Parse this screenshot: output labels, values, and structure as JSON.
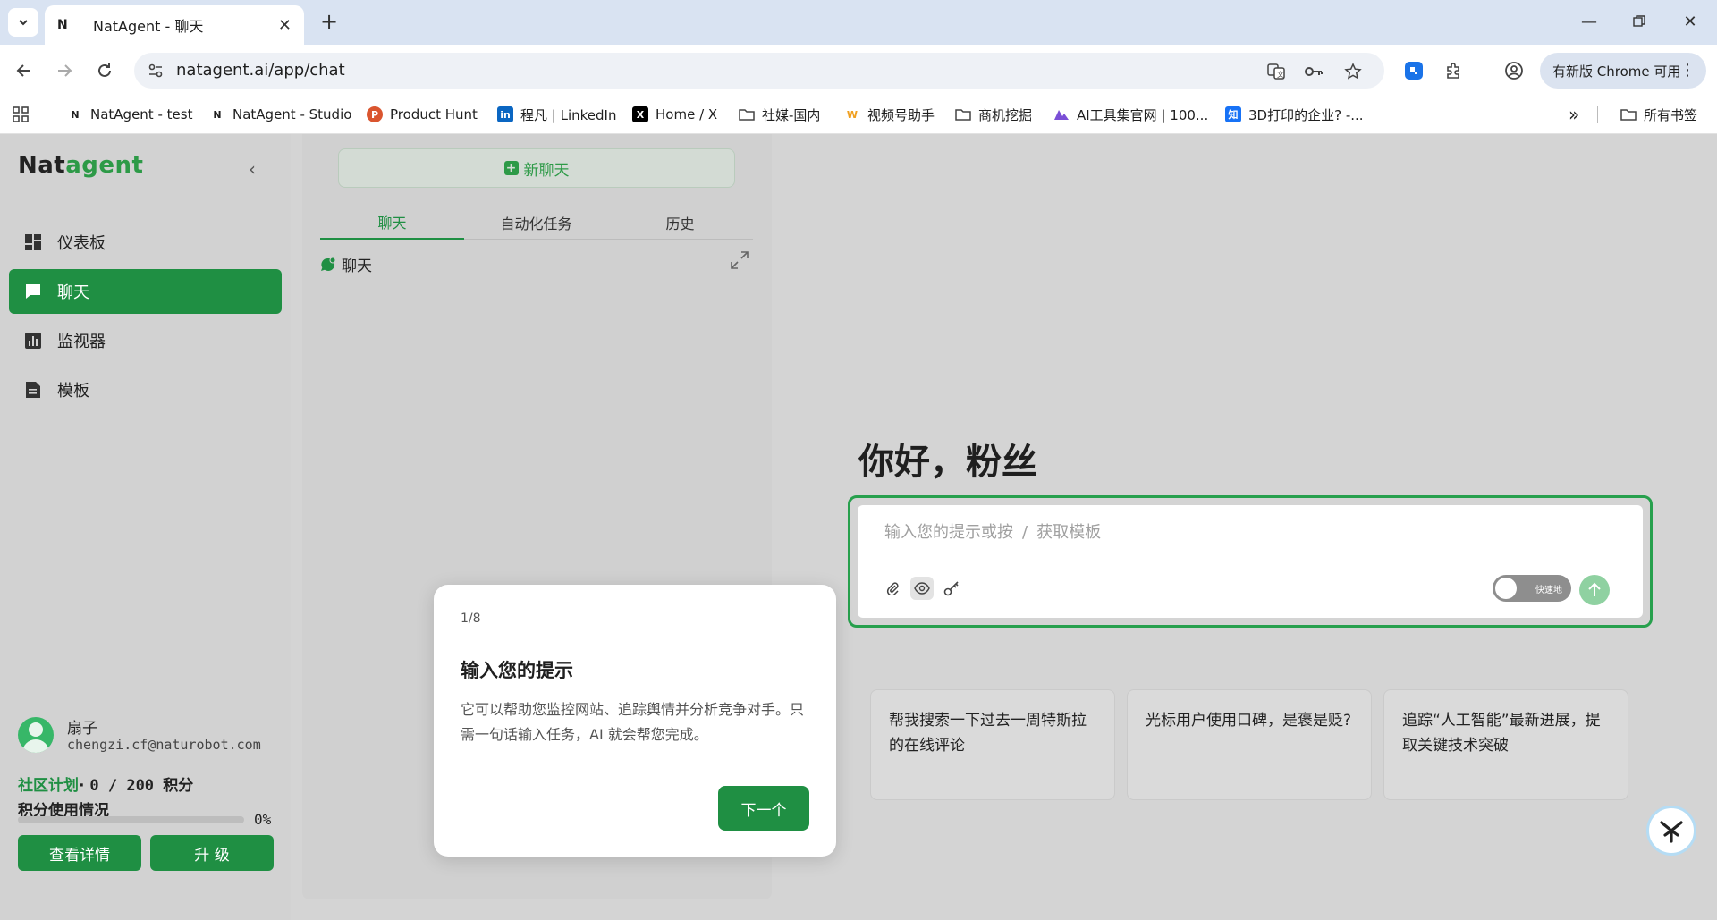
{
  "browser": {
    "tab_title": "NatAgent - 聊天",
    "tab_favicon": "N",
    "url": "natagent.ai/app/chat",
    "update_label": "有新版 Chrome 可用",
    "bookmarks": [
      {
        "icon": "N",
        "label": "NatAgent - test"
      },
      {
        "icon": "N",
        "label": "NatAgent - Studio"
      },
      {
        "icon": "P",
        "label": "Product Hunt"
      },
      {
        "icon": "in",
        "label": "程凡 | LinkedIn"
      },
      {
        "icon": "X",
        "label": "Home / X"
      },
      {
        "icon": "folder",
        "label": "社媒-国内"
      },
      {
        "icon": "W",
        "label": "视频号助手"
      },
      {
        "icon": "folder",
        "label": "商机挖掘"
      },
      {
        "icon": "ai",
        "label": "AI工具集官网 | 100..."
      },
      {
        "icon": "知",
        "label": "3D打印的企业? -..."
      }
    ],
    "all_bookmarks_label": "所有书签"
  },
  "sidebar": {
    "logo_nat": "Nat",
    "logo_agent": "agent",
    "nav": [
      {
        "label": "仪表板",
        "icon": "dashboard-icon"
      },
      {
        "label": "聊天",
        "icon": "chat-icon",
        "active": true
      },
      {
        "label": "监视器",
        "icon": "monitor-icon"
      },
      {
        "label": "模板",
        "icon": "template-icon"
      }
    ],
    "user_name": "扇子",
    "user_email": "chengzi.cf@naturobot.com",
    "plan_name": "社区计划",
    "plan_sep": "·",
    "plan_points": "0 / 200 积分",
    "usage_title": "积分使用情况",
    "usage_percent": "0%",
    "usage_fraction": 0,
    "details_button": "查看详情",
    "upgrade_button": "升 级"
  },
  "panel": {
    "new_chat_label": "新聊天",
    "tabs": [
      "聊天",
      "自动化任务",
      "历史"
    ],
    "active_tab": 0,
    "chat_item": "聊天"
  },
  "main": {
    "greeting": "你好，粉丝",
    "placeholder_a": "输入您的提示或按",
    "placeholder_slash": "/",
    "placeholder_b": "获取模板",
    "toggle_label": "快速地",
    "suggestions": [
      "帮我搜索一下过去一周特斯拉的在线评论",
      "光标用户使用口碑，是褒是贬?",
      "追踪“人工智能”最新进展，提取关键技术突破"
    ]
  },
  "popup": {
    "step": "1/8",
    "title": "输入您的提示",
    "description": "它可以帮助您监控网站、追踪舆情并分析竞争对手。只需一句话输入任务，AI 就会帮您完成。",
    "next_label": "下一个"
  },
  "colors": {
    "accent": "#1f8f43",
    "accent_light": "#27a04d"
  }
}
